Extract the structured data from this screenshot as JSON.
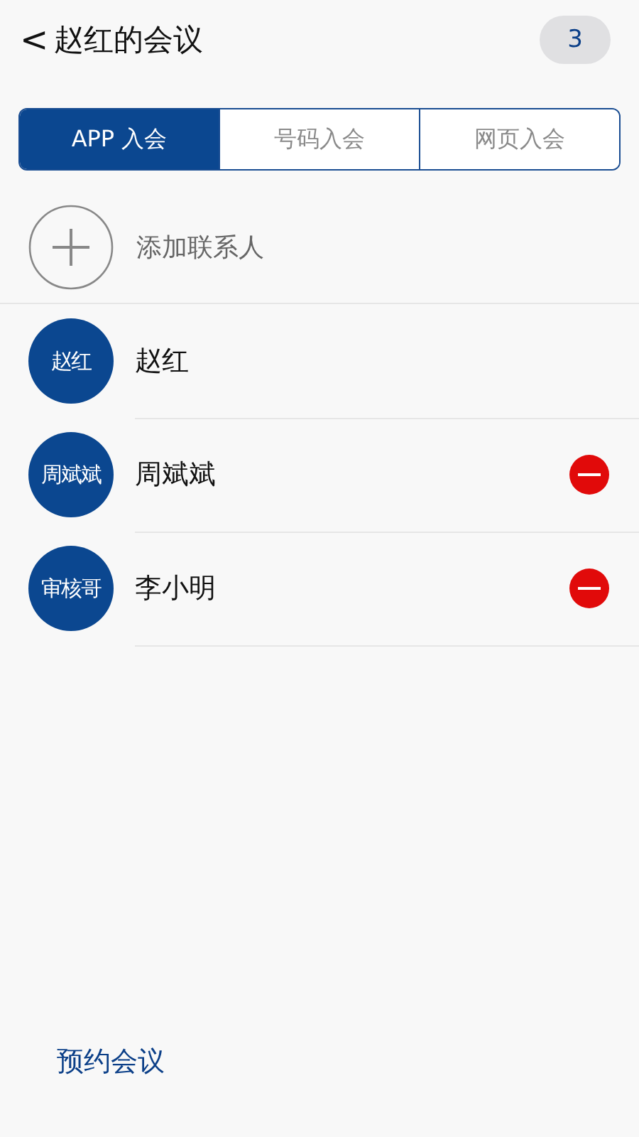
{
  "header": {
    "back": "<",
    "title": "赵红的会议",
    "count": "3"
  },
  "tabs": [
    {
      "label": "APP 入会",
      "selected": true
    },
    {
      "label": "号码入会",
      "selected": false
    },
    {
      "label": "网页入会",
      "selected": false
    }
  ],
  "add_contact": {
    "label": "添加联系人"
  },
  "participants": [
    {
      "avatar": "赵红",
      "name": "赵红",
      "removable": false
    },
    {
      "avatar": "周斌斌",
      "name": "周斌斌",
      "removable": true
    },
    {
      "avatar": "审核哥",
      "name": "李小明",
      "removable": true
    }
  ],
  "footer": {
    "schedule": "预约会议"
  }
}
